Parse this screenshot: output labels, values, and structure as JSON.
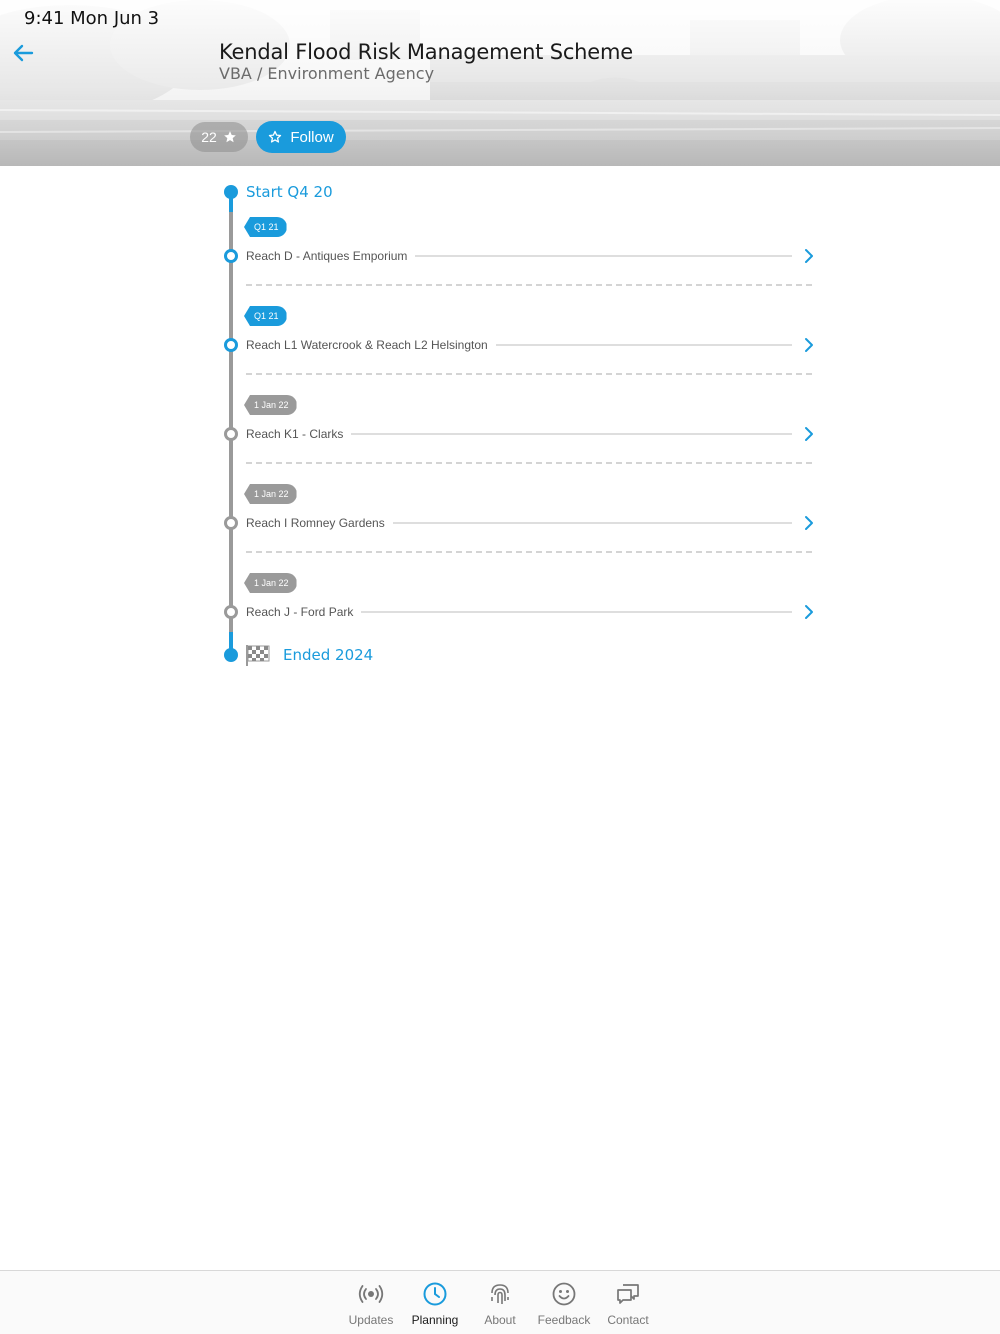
{
  "status_bar": {
    "time": "9:41  Mon Jun 3"
  },
  "header": {
    "title": "Kendal Flood Risk Management Scheme",
    "subtitle": "VBA / Environment Agency",
    "star_count": "22",
    "follow_label": "Follow"
  },
  "timeline": {
    "start_label": "Start Q4 20",
    "end_label": "Ended 2024",
    "items": [
      {
        "tag": "Q1 21",
        "label": "Reach D - Antiques Emporium",
        "status": "active"
      },
      {
        "tag": "Q1 21",
        "label": "Reach L1 Watercrook & Reach L2 Helsington",
        "status": "active"
      },
      {
        "tag": "1 Jan 22",
        "label": "Reach K1 - Clarks",
        "status": "inactive"
      },
      {
        "tag": "1 Jan 22",
        "label": "Reach I Romney Gardens",
        "status": "inactive"
      },
      {
        "tag": "1 Jan 22",
        "label": "Reach J - Ford Park",
        "status": "inactive"
      }
    ]
  },
  "tabbar": {
    "tabs": [
      {
        "label": "Updates",
        "icon": "broadcast-icon"
      },
      {
        "label": "Planning",
        "icon": "clock-icon",
        "active": true
      },
      {
        "label": "About",
        "icon": "fingerprint-icon"
      },
      {
        "label": "Feedback",
        "icon": "smiley-icon"
      },
      {
        "label": "Contact",
        "icon": "chat-icon"
      }
    ]
  },
  "colors": {
    "accent": "#1a9bdc",
    "inactive": "#9a9a9a"
  }
}
